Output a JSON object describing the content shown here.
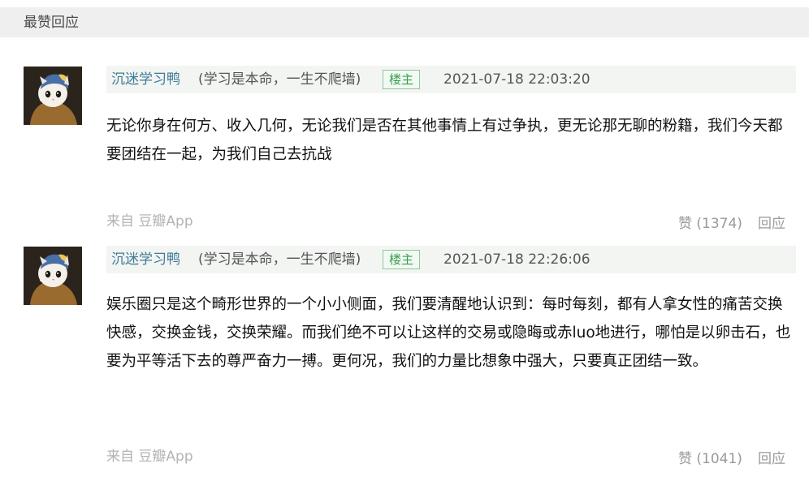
{
  "section": {
    "title": "最赞回应"
  },
  "comments": [
    {
      "author": "沉迷学习鸭",
      "signature": "(学习是本命，一生不爬墙)",
      "badge": "楼主",
      "timestamp": "2021-07-18 22:03:20",
      "body": "无论你身在何方、收入几何，无论我们是否在其他事情上有过争执，更无论那无聊的粉籍，我们今天都要团结在一起，为我们自己去抗战",
      "source": "来自 豆瓣App",
      "like_label": "赞 (1374)",
      "reply_label": "回应"
    },
    {
      "author": "沉迷学习鸭",
      "signature": "(学习是本命，一生不爬墙)",
      "badge": "楼主",
      "timestamp": "2021-07-18 22:26:06",
      "body": "娱乐圈只是这个畸形世界的一个小小侧面，我们要清醒地认识到：每时每刻，都有人拿女性的痛苦交换快感，交换金钱，交换荣耀。而我们绝不可以让这样的交易或隐晦或赤luo地进行，哪怕是以卵击石，也要为平等活下去的尊严奋力一搏。更何况，我们的力量比想象中强大，只要真正团结一致。",
      "source": "来自 豆瓣App",
      "like_label": "赞 (1041)",
      "reply_label": "回应"
    }
  ],
  "icons": {
    "avatar": "cat-with-pearl-earring-avatar"
  }
}
